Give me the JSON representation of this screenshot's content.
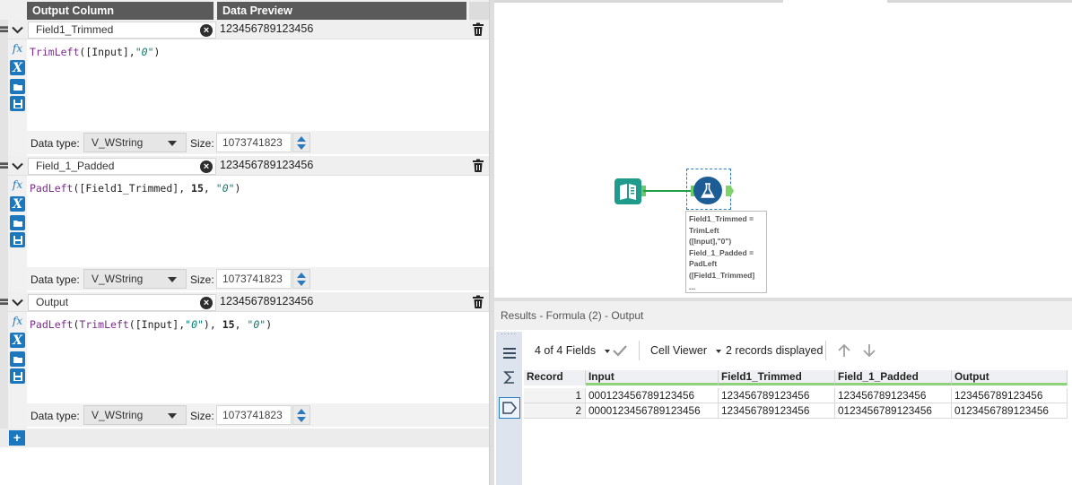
{
  "formula_panel": {
    "header": {
      "output_column": "Output Column",
      "data_preview": "Data Preview"
    },
    "formulas": [
      {
        "name": "Field1_Trimmed",
        "preview": "123456789123456",
        "expression": [
          {
            "t": "fn",
            "v": "TrimLeft"
          },
          {
            "t": "p",
            "v": "("
          },
          {
            "t": "fld",
            "v": "[Input]"
          },
          {
            "t": "p",
            "v": ","
          },
          {
            "t": "str",
            "v": "\"0\""
          },
          {
            "t": "p",
            "v": ")"
          }
        ],
        "data_type_label": "Data type:",
        "data_type": "V_WString",
        "size_label": "Size:",
        "size": "1073741823"
      },
      {
        "name": "Field_1_Padded",
        "preview": "123456789123456",
        "expression": [
          {
            "t": "fn",
            "v": "PadLeft"
          },
          {
            "t": "p",
            "v": "("
          },
          {
            "t": "fld",
            "v": "[Field1_Trimmed]"
          },
          {
            "t": "p",
            "v": ", "
          },
          {
            "t": "num",
            "v": "15"
          },
          {
            "t": "p",
            "v": ", "
          },
          {
            "t": "str",
            "v": "\"0\""
          },
          {
            "t": "p",
            "v": ")"
          }
        ],
        "data_type_label": "Data type:",
        "data_type": "V_WString",
        "size_label": "Size:",
        "size": "1073741823"
      },
      {
        "name": "Output",
        "preview": "123456789123456",
        "expression": [
          {
            "t": "fn",
            "v": "PadLeft"
          },
          {
            "t": "p",
            "v": "("
          },
          {
            "t": "fn",
            "v": "TrimLeft"
          },
          {
            "t": "p",
            "v": "("
          },
          {
            "t": "fld",
            "v": "[Input]"
          },
          {
            "t": "p",
            "v": ","
          },
          {
            "t": "str",
            "v": "\"0\""
          },
          {
            "t": "p",
            "v": "), "
          },
          {
            "t": "num",
            "v": "15"
          },
          {
            "t": "p",
            "v": ", "
          },
          {
            "t": "str",
            "v": "\"0\""
          },
          {
            "t": "p",
            "v": ")"
          }
        ],
        "data_type_label": "Data type:",
        "data_type": "V_WString",
        "size_label": "Size:",
        "size": "1073741823"
      }
    ],
    "add_label": "+",
    "clear_glyph": "×",
    "icons": [
      "fx-icon",
      "variable-x-icon",
      "open-folder-icon",
      "save-icon",
      "trash-icon",
      "chevron-down-icon"
    ]
  },
  "canvas": {
    "annotation": "Field1_Trimmed =\nTrimLeft\n([Input],\"0\")\nField_1_Padded =\nPadLeft\n([Field1_Trimmed]\n...",
    "colors": {
      "input_node": "#1e9b8a",
      "formula_node": "#1d5d96",
      "connection": "#21a04a"
    }
  },
  "results": {
    "title": "Results - Formula (2) - Output",
    "fields_selector": "4 of 4 Fields",
    "cell_viewer": "Cell Viewer",
    "records_displayed": "2 records displayed",
    "columns": [
      "Record",
      "Input",
      "Field1_Trimmed",
      "Field_1_Padded",
      "Output"
    ],
    "rows": [
      [
        "1",
        "000123456789123456",
        "123456789123456",
        "123456789123456",
        "123456789123456"
      ],
      [
        "2",
        "0000123456789123456",
        "123456789123456",
        "0123456789123456",
        "0123456789123456"
      ]
    ]
  }
}
